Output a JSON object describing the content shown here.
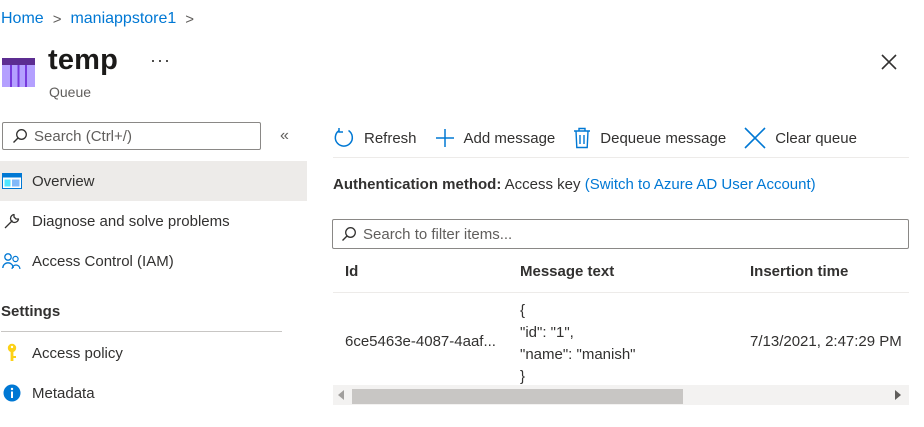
{
  "breadcrumb": {
    "home": "Home",
    "sep1": ">",
    "store": "maniappstore1",
    "sep2": ">"
  },
  "header": {
    "title": "temp",
    "subtitle": "Queue",
    "more": "···"
  },
  "sidebar": {
    "search_placeholder": "Search (Ctrl+/)",
    "collapse": "«",
    "items": [
      {
        "label": "Overview",
        "icon": "overview-icon",
        "selected": true
      },
      {
        "label": "Diagnose and solve problems",
        "icon": "wrench-icon"
      },
      {
        "label": "Access Control (IAM)",
        "icon": "people-icon"
      }
    ],
    "section_title": "Settings",
    "settings_items": [
      {
        "label": "Access policy",
        "icon": "key-icon"
      },
      {
        "label": "Metadata",
        "icon": "info-icon"
      }
    ]
  },
  "toolbar": {
    "refresh": "Refresh",
    "add": "Add message",
    "dequeue": "Dequeue message",
    "clear": "Clear queue"
  },
  "auth": {
    "label": "Authentication method:",
    "value": "Access key",
    "link": "(Switch to Azure AD User Account)"
  },
  "filter": {
    "placeholder": "Search to filter items..."
  },
  "table": {
    "headers": [
      "Id",
      "Message text",
      "Insertion time"
    ],
    "rows": [
      {
        "id": "6ce5463e-4087-4aaf...",
        "message": "{\n\"id\": \"1\",\n\"name\": \"manish\"\n}",
        "insertion_time": "7/13/2021, 2:47:29 PM"
      }
    ]
  },
  "colors": {
    "accent": "#0078d4",
    "selected_bg": "#edebe9",
    "key": "#fcd116"
  }
}
